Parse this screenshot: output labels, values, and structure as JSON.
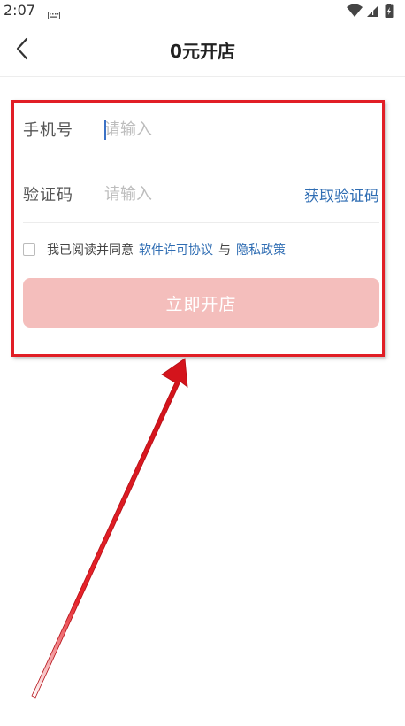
{
  "status_bar": {
    "time": "2:07",
    "icons": [
      "keyboard-icon",
      "wifi-icon",
      "signal-icon",
      "battery-icon"
    ]
  },
  "header": {
    "back_icon": "chevron-left-icon",
    "title": "0元开店"
  },
  "form": {
    "phone_label": "手机号",
    "phone_placeholder": "请输入",
    "phone_value": "",
    "code_label": "验证码",
    "code_placeholder": "请输入",
    "code_value": "",
    "get_code_label": "获取验证码",
    "agree_checked": false,
    "agree_text": "我已阅读并同意",
    "license_link": "软件许可协议",
    "and_text": "与",
    "privacy_link": "隐私政策",
    "submit_label": "立即开店"
  },
  "colors": {
    "accent_blue": "#2f6db3",
    "submit_bg": "#f4bebc",
    "annotation_red": "#e11e26"
  }
}
